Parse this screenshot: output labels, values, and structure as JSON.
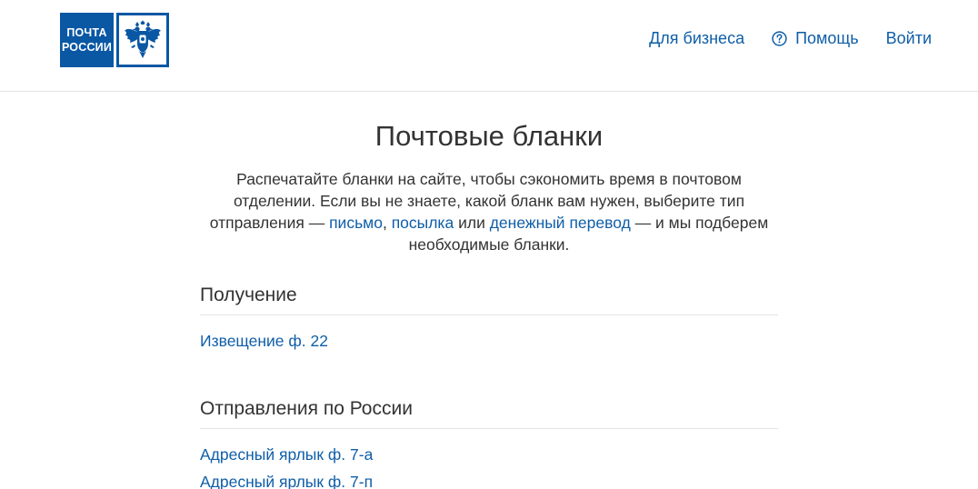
{
  "header": {
    "logo": {
      "line1": "ПОЧТА",
      "line2": "РОССИИ",
      "emblem_icon": "double-headed-eagle-icon"
    },
    "nav": {
      "business": "Для бизнеса",
      "help": "Помощь",
      "help_icon": "question-circle-icon",
      "login": "Войти"
    }
  },
  "main": {
    "title": "Почтовые бланки",
    "intro": {
      "part1": "Распечатайте бланки на сайте, чтобы сэкономить время в почтовом отделении. Если вы не знаете, какой бланк вам нужен, выберите тип отправления — ",
      "link_letter": "письмо",
      "sep1": ", ",
      "link_parcel": "посылка",
      "sep2": " или ",
      "link_money": "денежный перевод",
      "part2": " — и мы подберем необходимые бланки."
    },
    "sections": [
      {
        "title": "Получение",
        "items": [
          "Извещение ф. 22"
        ]
      },
      {
        "title": "Отправления по России",
        "items": [
          "Адресный ярлык ф. 7-а",
          "Адресный ярлык ф. 7-п"
        ]
      }
    ]
  },
  "colors": {
    "brand": "#0a57a4",
    "link": "#0f5ea8",
    "text": "#333333",
    "divider": "#e3e3e3"
  }
}
